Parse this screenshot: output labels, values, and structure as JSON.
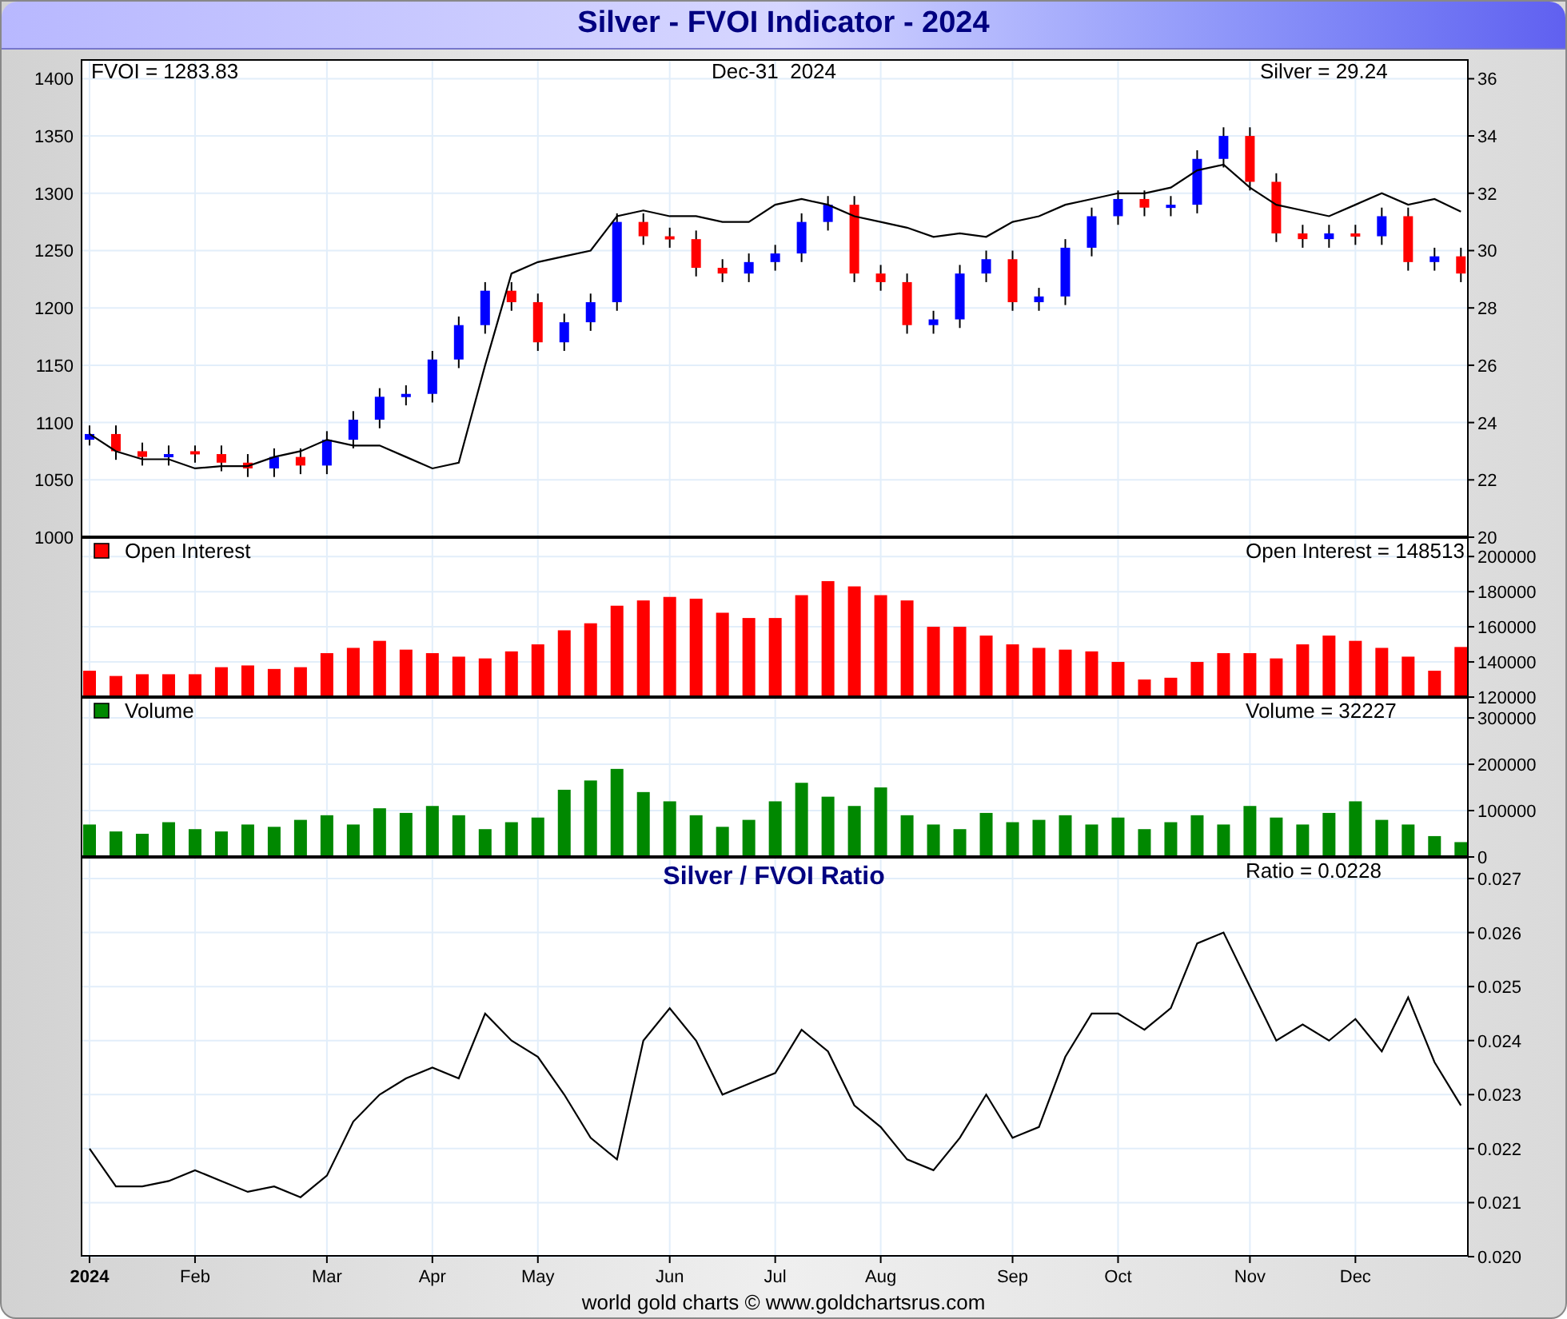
{
  "title": "Silver - FVOI Indicator - 2024",
  "main": {
    "fvoi_label": "FVOI = 1283.83",
    "date_label": "Dec-31  2024",
    "silver_label": "Silver = 29.24",
    "price": {
      "chart_data": {
        "type": "candlestick",
        "grid": true,
        "ylim": [
          20,
          36.68
        ],
        "yticks": [
          20,
          22,
          24,
          26,
          28,
          30,
          32,
          34,
          36
        ],
        "ohlc": [
          [
            23.4,
            23.9,
            23.2,
            23.6
          ],
          [
            23.6,
            23.9,
            22.7,
            23.0
          ],
          [
            23.0,
            23.3,
            22.5,
            22.8
          ],
          [
            22.8,
            23.2,
            22.5,
            22.9
          ],
          [
            23.0,
            23.2,
            22.6,
            22.9
          ],
          [
            22.9,
            23.2,
            22.3,
            22.6
          ],
          [
            22.6,
            22.9,
            22.1,
            22.4
          ],
          [
            22.4,
            23.1,
            22.1,
            22.8
          ],
          [
            22.8,
            23.1,
            22.2,
            22.5
          ],
          [
            22.5,
            23.7,
            22.2,
            23.4
          ],
          [
            23.4,
            24.4,
            23.1,
            24.1
          ],
          [
            24.1,
            25.2,
            23.8,
            24.9
          ],
          [
            24.9,
            25.3,
            24.6,
            25.0
          ],
          [
            25.0,
            26.5,
            24.7,
            26.2
          ],
          [
            26.2,
            27.7,
            25.9,
            27.4
          ],
          [
            27.4,
            28.9,
            27.1,
            28.6
          ],
          [
            28.6,
            28.9,
            27.9,
            28.2
          ],
          [
            28.2,
            28.5,
            26.5,
            26.8
          ],
          [
            26.8,
            27.8,
            26.5,
            27.5
          ],
          [
            27.5,
            28.5,
            27.2,
            28.2
          ],
          [
            28.2,
            31.3,
            27.9,
            31.0
          ],
          [
            31.0,
            31.3,
            30.2,
            30.5
          ],
          [
            30.5,
            30.8,
            30.1,
            30.4
          ],
          [
            30.4,
            30.7,
            29.1,
            29.4
          ],
          [
            29.4,
            29.7,
            28.9,
            29.2
          ],
          [
            29.2,
            29.9,
            28.9,
            29.6
          ],
          [
            29.6,
            30.2,
            29.3,
            29.9
          ],
          [
            29.9,
            31.3,
            29.6,
            31.0
          ],
          [
            31.0,
            31.9,
            30.7,
            31.6
          ],
          [
            31.6,
            31.9,
            28.9,
            29.2
          ],
          [
            29.2,
            29.5,
            28.6,
            28.9
          ],
          [
            28.9,
            29.2,
            27.1,
            27.4
          ],
          [
            27.4,
            27.9,
            27.1,
            27.6
          ],
          [
            27.6,
            29.5,
            27.3,
            29.2
          ],
          [
            29.2,
            30.0,
            28.9,
            29.7
          ],
          [
            29.7,
            30.0,
            27.9,
            28.2
          ],
          [
            28.2,
            28.7,
            27.9,
            28.4
          ],
          [
            28.4,
            30.4,
            28.1,
            30.1
          ],
          [
            30.1,
            31.5,
            29.8,
            31.2
          ],
          [
            31.2,
            32.1,
            30.9,
            31.8
          ],
          [
            31.8,
            32.1,
            31.2,
            31.5
          ],
          [
            31.5,
            31.9,
            31.2,
            31.6
          ],
          [
            31.6,
            33.5,
            31.3,
            33.2
          ],
          [
            33.2,
            34.3,
            32.9,
            34.0
          ],
          [
            34.0,
            34.3,
            32.1,
            32.4
          ],
          [
            32.4,
            32.7,
            30.3,
            30.6
          ],
          [
            30.6,
            30.9,
            30.1,
            30.4
          ],
          [
            30.4,
            30.9,
            30.1,
            30.6
          ],
          [
            30.6,
            30.9,
            30.2,
            30.5
          ],
          [
            30.5,
            31.5,
            30.2,
            31.2
          ],
          [
            31.2,
            31.5,
            29.3,
            29.6
          ],
          [
            29.6,
            30.1,
            29.3,
            29.8
          ],
          [
            29.8,
            30.1,
            28.9,
            29.2
          ]
        ]
      }
    },
    "fvoi": {
      "chart_data": {
        "type": "line",
        "ylim": [
          1000,
          1417
        ],
        "yticks": [
          1000,
          1050,
          1100,
          1150,
          1200,
          1250,
          1300,
          1350,
          1400
        ],
        "series": [
          {
            "color": "#000000",
            "values": [
              1090,
              1075,
              1068,
              1068,
              1060,
              1062,
              1062,
              1070,
              1075,
              1085,
              1080,
              1080,
              1070,
              1060,
              1065,
              1150,
              1230,
              1240,
              1245,
              1250,
              1280,
              1285,
              1280,
              1280,
              1275,
              1275,
              1290,
              1295,
              1290,
              1280,
              1275,
              1270,
              1262,
              1265,
              1262,
              1275,
              1280,
              1290,
              1295,
              1300,
              1300,
              1305,
              1320,
              1325,
              1305,
              1290,
              1285,
              1280,
              1290,
              1300,
              1290,
              1295,
              1284
            ]
          }
        ]
      }
    }
  },
  "open_interest": {
    "color": "#ff0000",
    "reading": "Open Interest = 148513",
    "chart_data": {
      "type": "bar",
      "grid": true,
      "ylim": [
        120000,
        211000
      ],
      "yticks": [
        120000,
        140000,
        160000,
        180000,
        200000
      ],
      "series": [
        {
          "name": "Open Interest",
          "color": "#ff0000",
          "values": [
            135000,
            132000,
            133000,
            133000,
            133000,
            137000,
            138000,
            136000,
            137000,
            145000,
            148000,
            152000,
            147000,
            145000,
            143000,
            142000,
            146000,
            150000,
            158000,
            162000,
            172000,
            175000,
            177000,
            176000,
            168000,
            165000,
            165000,
            178000,
            186000,
            183000,
            178000,
            175000,
            160000,
            160000,
            155000,
            150000,
            148000,
            147000,
            146000,
            140000,
            130000,
            131000,
            140000,
            145000,
            145000,
            142000,
            150000,
            155000,
            152000,
            148000,
            143000,
            135000,
            148500
          ]
        }
      ]
    }
  },
  "volume": {
    "color": "#008800",
    "reading": "Volume = 32227",
    "chart_data": {
      "type": "bar",
      "grid": true,
      "ylim": [
        0,
        345000
      ],
      "yticks": [
        0,
        100000,
        200000,
        300000
      ],
      "series": [
        {
          "name": "Volume",
          "color": "#008800",
          "values": [
            70000,
            55000,
            50000,
            75000,
            60000,
            55000,
            70000,
            65000,
            80000,
            90000,
            70000,
            105000,
            95000,
            110000,
            90000,
            60000,
            75000,
            85000,
            145000,
            165000,
            190000,
            140000,
            120000,
            90000,
            65000,
            80000,
            120000,
            160000,
            130000,
            110000,
            150000,
            90000,
            70000,
            60000,
            95000,
            75000,
            80000,
            90000,
            70000,
            85000,
            60000,
            75000,
            90000,
            70000,
            110000,
            85000,
            70000,
            95000,
            120000,
            80000,
            70000,
            45000,
            32000
          ]
        }
      ]
    }
  },
  "ratio": {
    "title": "Silver / FVOI Ratio",
    "reading": "Ratio = 0.0228",
    "chart_data": {
      "type": "line",
      "grid": true,
      "ylim": [
        0.02,
        0.0274
      ],
      "yticks": [
        {
          "value": 0.02,
          "label": "0.020"
        },
        0.021,
        0.022,
        0.023,
        0.024,
        0.025,
        0.026,
        0.027
      ],
      "categories": [
        "2024",
        null,
        null,
        null,
        "Feb",
        null,
        null,
        null,
        null,
        "Mar",
        null,
        null,
        null,
        "Apr",
        null,
        null,
        null,
        "May",
        null,
        null,
        null,
        null,
        "Jun",
        null,
        null,
        null,
        "Jul",
        null,
        null,
        null,
        "Aug",
        null,
        null,
        null,
        null,
        "Sep",
        null,
        null,
        null,
        "Oct",
        null,
        null,
        null,
        null,
        "Nov",
        null,
        null,
        null,
        "Dec",
        null,
        null,
        null,
        null
      ],
      "series": [
        {
          "color": "#000000",
          "values": [
            0.022,
            0.0213,
            0.0213,
            0.0214,
            0.0216,
            0.0214,
            0.0212,
            0.0213,
            0.0211,
            0.0215,
            0.0225,
            0.023,
            0.0233,
            0.0235,
            0.0233,
            0.0245,
            0.024,
            0.0237,
            0.023,
            0.0222,
            0.0218,
            0.024,
            0.0246,
            0.024,
            0.023,
            0.0232,
            0.0234,
            0.0242,
            0.0238,
            0.0228,
            0.0224,
            0.0218,
            0.0216,
            0.0222,
            0.023,
            0.0222,
            0.0224,
            0.0237,
            0.0245,
            0.0245,
            0.0242,
            0.0246,
            0.0258,
            0.026,
            0.025,
            0.024,
            0.0243,
            0.024,
            0.0244,
            0.0238,
            0.0248,
            0.0236,
            0.0228
          ]
        }
      ]
    }
  },
  "footer": "world gold charts © www.goldchartsrus.com"
}
